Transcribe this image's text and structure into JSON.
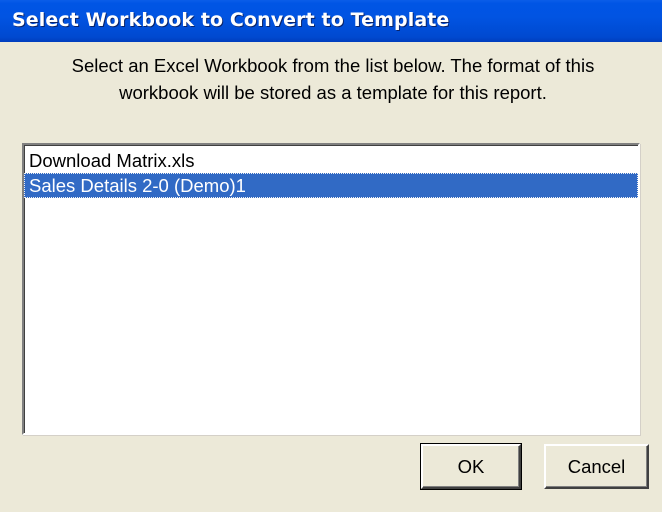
{
  "window": {
    "title": "Select Workbook to Convert to Template"
  },
  "instructions": {
    "line1": "Select an Excel Workbook from the list below. The format of this",
    "line2": "workbook will be stored as a template for this report."
  },
  "workbook_list": {
    "items": [
      {
        "label": "Download Matrix.xls",
        "selected": false
      },
      {
        "label": "Sales Details 2-0 (Demo)1",
        "selected": true
      }
    ]
  },
  "buttons": {
    "ok_label": "OK",
    "cancel_label": "Cancel"
  },
  "colors": {
    "title_bar": "#0054e3",
    "dialog_background": "#ece9d8",
    "selection_highlight": "#316ac5"
  }
}
